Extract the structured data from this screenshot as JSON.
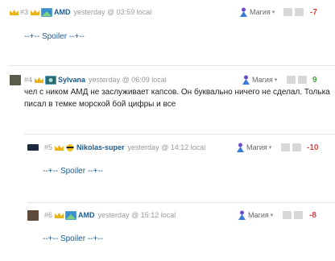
{
  "posts": [
    {
      "number": "#3",
      "username": "AMD",
      "timestamp": "yesterday @ 03:59 local",
      "magic_label": "Магия",
      "score": "-7",
      "score_color": "#e04040",
      "spoiler": "--+-- Spoiler --+--"
    },
    {
      "number": "#4",
      "username": "Sylvana",
      "timestamp": "yesterday @ 06:09 local",
      "magic_label": "Магия",
      "score": "9",
      "score_color": "#3aa33a",
      "text_lines": [
        "чел с ником АМД не заслуживает капсов. Он буквально ничего не сделал. Толька",
        "писал в темке морской бой цифры и все"
      ]
    },
    {
      "number": "#5",
      "username": "Nikolas-super",
      "timestamp": "yesterday @ 14:12 local",
      "magic_label": "Магия",
      "score": "-10",
      "score_color": "#e04040",
      "spoiler": "--+-- Spoiler --+--"
    },
    {
      "number": "#6",
      "username": "AMD",
      "timestamp": "yesterday @ 15:12 local",
      "magic_label": "Магия",
      "score": "-8",
      "score_color": "#e04040",
      "spoiler": "--+-- Spoiler --+--"
    }
  ],
  "colors": {
    "username": "#1c5a8c",
    "negative": "#e04040",
    "positive": "#3aa33a"
  }
}
